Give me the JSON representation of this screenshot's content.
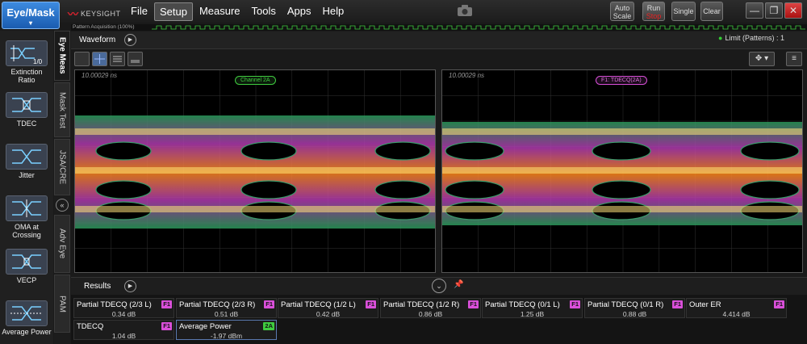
{
  "app": {
    "mode_button": "Eye/Mask",
    "brand": "KEYSIGHT",
    "menu": [
      "File",
      "Setup",
      "Measure",
      "Tools",
      "Apps",
      "Help"
    ],
    "active_menu": "Setup",
    "buttons": {
      "auto_scale_1": "Auto",
      "auto_scale_2": "Scale",
      "run": "Run",
      "stop": "Stop",
      "single": "Single",
      "clear": "Clear"
    },
    "window": {
      "minimize": "—",
      "restore": "❐",
      "close": "✕"
    }
  },
  "sidebar": {
    "items": [
      {
        "label": "Extinction Ratio",
        "icon": "extinction-ratio-icon",
        "sub": "1/0"
      },
      {
        "label": "TDEC",
        "icon": "tdec-icon"
      },
      {
        "label": "Jitter",
        "icon": "jitter-icon"
      },
      {
        "label": "OMA at Crossing",
        "icon": "oma-icon"
      },
      {
        "label": "VECP",
        "icon": "vecp-icon"
      },
      {
        "label": "Average Power",
        "icon": "average-power-icon"
      }
    ]
  },
  "vtabs": [
    "Eye Meas",
    "Mask Test",
    "JSA/CRE",
    "Adv Eye",
    "PAM"
  ],
  "acquisition": {
    "label": "Pattern Acquisition (100%)"
  },
  "waveform": {
    "title": "Waveform",
    "limit_label": "Limit (Patterns) : 1"
  },
  "panels": [
    {
      "time": "10.00029 ns",
      "label": "Channel 2A",
      "color": "#3fcc3f"
    },
    {
      "time": "10.00029 ns",
      "label": "F1: TDECQ(2A)",
      "color": "#d94fd9"
    }
  ],
  "results": {
    "title": "Results",
    "cells": [
      {
        "name": "Partial TDECQ (2/3 L)",
        "value": "0.34 dB",
        "badge": "F1"
      },
      {
        "name": "Partial TDECQ (2/3 R)",
        "value": "0.51 dB",
        "badge": "F1"
      },
      {
        "name": "Partial TDECQ (1/2 L)",
        "value": "0.42 dB",
        "badge": "F1"
      },
      {
        "name": "Partial TDECQ (1/2 R)",
        "value": "0.86 dB",
        "badge": "F1"
      },
      {
        "name": "Partial TDECQ (0/1 L)",
        "value": "1.25 dB",
        "badge": "F1"
      },
      {
        "name": "Partial TDECQ (0/1 R)",
        "value": "0.88 dB",
        "badge": "F1"
      },
      {
        "name": "Outer ER",
        "value": "4.414 dB",
        "badge": "F1"
      },
      {
        "name": "TDECQ",
        "value": "1.04 dB",
        "badge": "F1"
      },
      {
        "name": "Average Power",
        "value": "-1.97 dBm",
        "badge": "2A"
      }
    ]
  },
  "colors": {
    "f1_badge": "#d94fd9",
    "ch2a_badge": "#3fcc3f",
    "accent": "#2a6fc9"
  }
}
